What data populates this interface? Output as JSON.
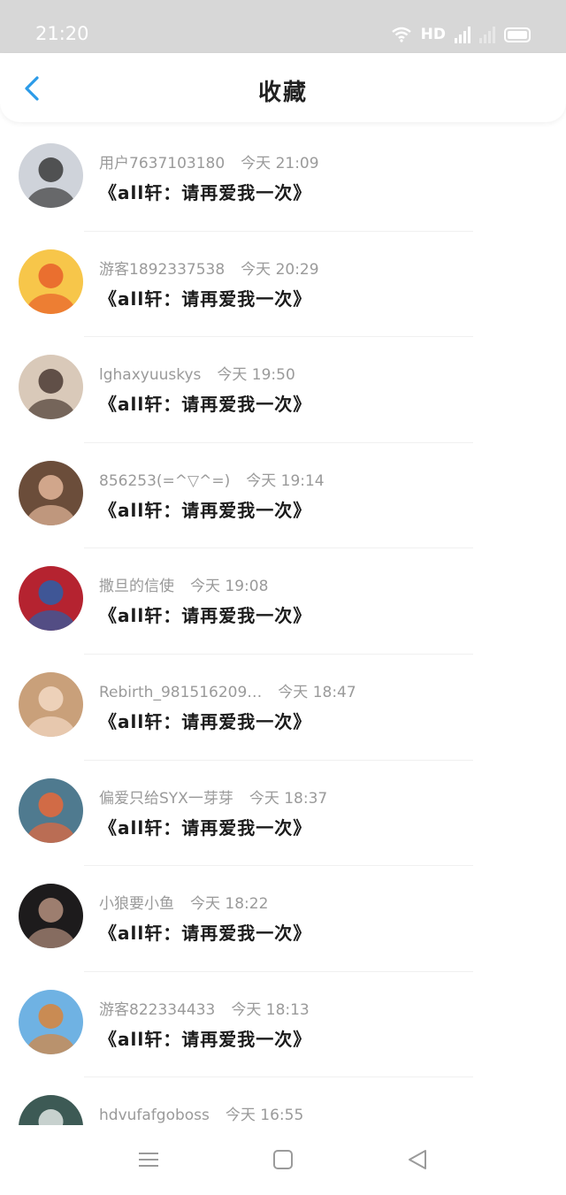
{
  "status_bar": {
    "time": "21:20",
    "network": "HD",
    "cell_label": "4G"
  },
  "header": {
    "title": "收藏",
    "back_icon": "chevron-left-icon",
    "accent": "#2b9be8"
  },
  "items": [
    {
      "user": "用户7637103180",
      "time": "今天 21:09",
      "title": "《all轩：请再爱我一次》",
      "avatar_colors": [
        "#cfd3da",
        "#3a3a3a"
      ]
    },
    {
      "user": "游客1892337538",
      "time": "今天 20:29",
      "title": "《all轩：请再爱我一次》",
      "avatar_colors": [
        "#f7c64a",
        "#e85f2a"
      ]
    },
    {
      "user": "lghaxyuuskys",
      "time": "今天 19:50",
      "title": "《all轩：请再爱我一次》",
      "avatar_colors": [
        "#d9c9b9",
        "#4a3a32"
      ]
    },
    {
      "user": "856253(=^▽^=)",
      "time": "今天 19:14",
      "title": "《all轩：请再爱我一次》",
      "avatar_colors": [
        "#6b4d3a",
        "#e3b69a"
      ]
    },
    {
      "user": "撒旦的信使",
      "time": "今天 19:08",
      "title": "《all轩：请再爱我一次》",
      "avatar_colors": [
        "#b52330",
        "#2a5fa8"
      ]
    },
    {
      "user": "Rebirth_981516209…",
      "time": "今天 18:47",
      "title": "《all轩：请再爱我一次》",
      "avatar_colors": [
        "#c9a07a",
        "#f3d9c4"
      ]
    },
    {
      "user": "偏爱只给SYX一芽芽",
      "time": "今天 18:37",
      "title": "《all轩：请再爱我一次》",
      "avatar_colors": [
        "#4f7a8f",
        "#e8683a"
      ]
    },
    {
      "user": "小狼要小鱼",
      "time": "今天 18:22",
      "title": "《all轩：请再爱我一次》",
      "avatar_colors": [
        "#1d1b1c",
        "#b48f7e"
      ]
    },
    {
      "user": "游客822334433",
      "time": "今天 18:13",
      "title": "《all轩：请再爱我一次》",
      "avatar_colors": [
        "#6fb2e3",
        "#d9843a"
      ]
    },
    {
      "user": "hdvufafgoboss",
      "time": "今天 16:55",
      "title": "",
      "avatar_colors": [
        "#3d5a55",
        "#dfe6e4"
      ]
    }
  ],
  "nav_bar": {
    "menu_icon": "menu-icon",
    "home_icon": "home-square-icon",
    "back_icon": "triangle-back-icon"
  }
}
